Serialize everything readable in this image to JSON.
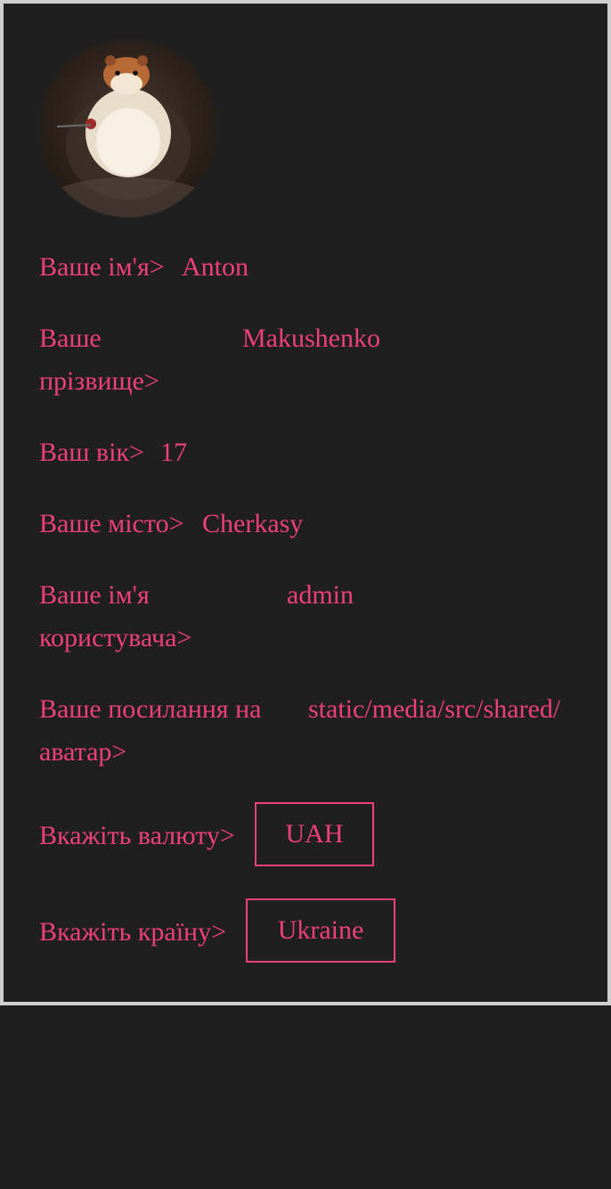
{
  "profile": {
    "avatar_alt": "avatar",
    "fields": {
      "first_name": {
        "label": "Ваше ім'я>",
        "value": "Anton"
      },
      "last_name": {
        "label_line1": "Ваше",
        "label_line2": "прізвище>",
        "value": "Makushenko"
      },
      "age": {
        "label": "Ваш вік>",
        "value": "17"
      },
      "city": {
        "label": "Ваше місто>",
        "value": "Cherkasy"
      },
      "username": {
        "label_line1": "Ваше ім'я",
        "label_line2": "користувача>",
        "value": "admin"
      },
      "avatar_link": {
        "label_line1": "Ваше посилання на",
        "label_line2": "аватар>",
        "value": "static/media/src/shared/"
      }
    },
    "currency": {
      "label": "Вкажіть валюту>",
      "selected": "UAH"
    },
    "country": {
      "label": "Вкажіть країну>",
      "selected": "Ukraine"
    }
  },
  "colors": {
    "accent": "#ef3f7c",
    "background": "#1f1f1f",
    "border": "#cfcfcf"
  }
}
